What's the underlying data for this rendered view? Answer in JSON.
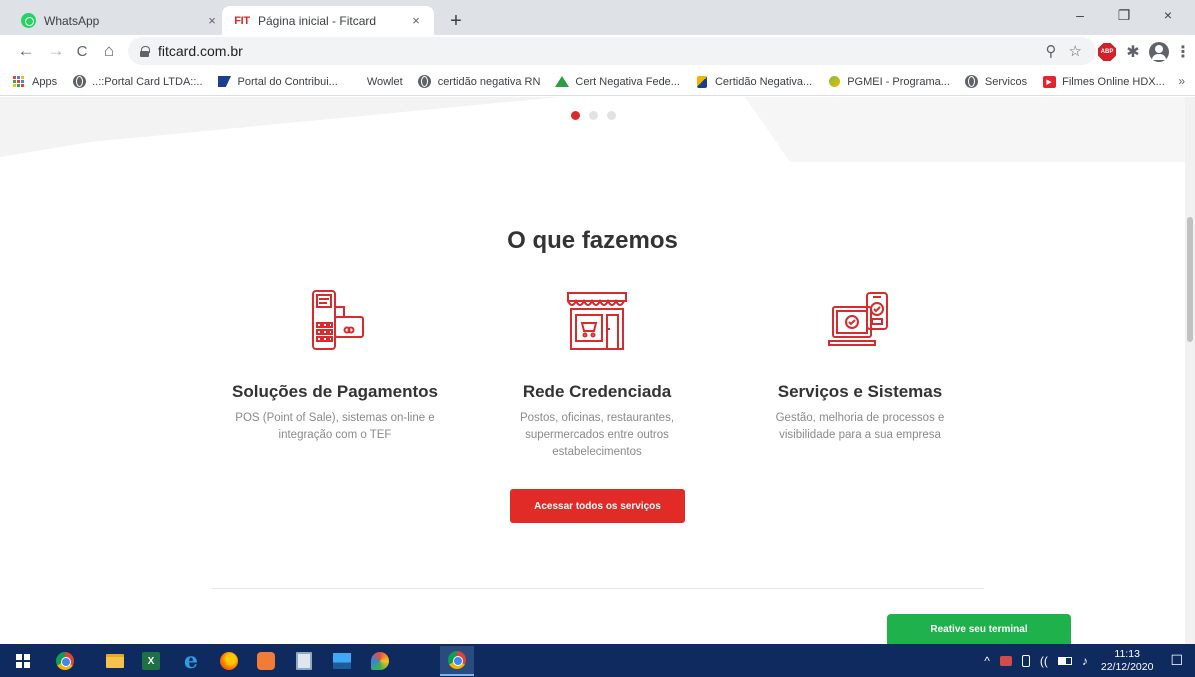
{
  "browser": {
    "tabs": [
      {
        "title": "WhatsApp",
        "close": "×",
        "icon": "whatsapp-icon"
      },
      {
        "title": "Página inicial - Fitcard",
        "logo": "FIT",
        "close": "×",
        "icon": "fitcard-icon"
      }
    ],
    "new_tab": "+",
    "window_controls": {
      "minimize": "–",
      "restore": "❐",
      "close": "×"
    },
    "nav": {
      "back": "←",
      "forward": "→",
      "reload": "C",
      "home": "⌂"
    },
    "url": "fitcard.com.br",
    "omnibox_icons": {
      "zoom": "⚲",
      "star": "☆"
    },
    "extensions": {
      "abp": "ABP",
      "puzzle": "✱",
      "menu": "⋮"
    },
    "bookmarks": [
      {
        "label": "Apps",
        "icon": "apps-grid-icon"
      },
      {
        "label": "..::Portal Card LTDA::..",
        "icon": "globe-icon"
      },
      {
        "label": "Portal do Contribui...",
        "icon": "portal-icon"
      },
      {
        "label": "Wowlet",
        "icon": "none"
      },
      {
        "label": "certidão negativa RN",
        "icon": "globe-icon"
      },
      {
        "label": "Cert Negativa Fede...",
        "icon": "receita-icon"
      },
      {
        "label": "Certidão Negativa...",
        "icon": "fgts-icon"
      },
      {
        "label": "PGMEI - Programa...",
        "icon": "pgmei-icon"
      },
      {
        "label": "Servicos",
        "icon": "globe-icon"
      },
      {
        "label": "Filmes Online HDX...",
        "icon": "video-icon"
      }
    ],
    "bookmarks_more": "»"
  },
  "page": {
    "carousel": {
      "count": 3,
      "active": 0
    },
    "section_title": "O que fazemos",
    "services": [
      {
        "title": "Soluções de Pagamentos",
        "desc": "POS (Point of Sale), sistemas on-line e integração com o TEF",
        "icon": "pos-terminal-icon"
      },
      {
        "title": "Rede Credenciada",
        "desc": "Postos, oficinas, restaurantes, supermercados entre outros estabelecimentos",
        "icon": "storefront-icon"
      },
      {
        "title": "Serviços e Sistemas",
        "desc": "Gestão, melhoria de processos e visibilidade para a sua empresa",
        "icon": "devices-check-icon"
      }
    ],
    "cta_label": "Acessar todos os serviços",
    "float_button": "Reative seu terminal",
    "accent_color": "#e02b27",
    "green_color": "#1fb14c"
  },
  "taskbar": {
    "time": "11:13",
    "date": "22/12/2020",
    "tray": {
      "chevron": "^",
      "network": "((",
      "volume": "♪",
      "notifications": "☐"
    }
  }
}
